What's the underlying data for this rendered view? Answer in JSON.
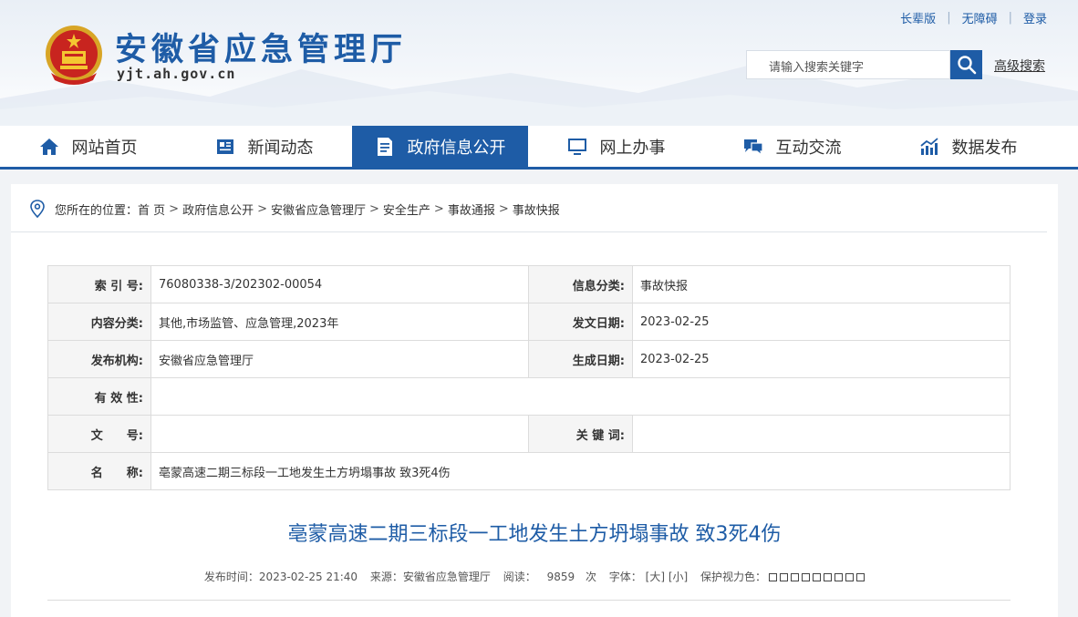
{
  "header": {
    "site_title": "安徽省应急管理厅",
    "site_domain": "yjt.ah.gov.cn",
    "top_links": [
      "长辈版",
      "无障碍",
      "登录"
    ],
    "search_placeholder": "请输入搜索关键字",
    "advanced_search": "高级搜索"
  },
  "nav": {
    "items": [
      {
        "label": "网站首页",
        "icon": "home-icon"
      },
      {
        "label": "新闻动态",
        "icon": "news-icon"
      },
      {
        "label": "政府信息公开",
        "icon": "document-icon",
        "active": true
      },
      {
        "label": "网上办事",
        "icon": "monitor-icon"
      },
      {
        "label": "互动交流",
        "icon": "chat-icon"
      },
      {
        "label": "数据发布",
        "icon": "chart-icon"
      }
    ]
  },
  "breadcrumb": {
    "prefix": "您所在的位置：",
    "items": [
      "首 页",
      "政府信息公开",
      "安徽省应急管理厅",
      "安全生产",
      "事故通报",
      "事故快报"
    ]
  },
  "meta": {
    "index_label": "索 引 号:",
    "index_value": "76080338-3/202302-00054",
    "category_label": "信息分类:",
    "category_value": "事故快报",
    "content_label": "内容分类:",
    "content_value": "其他,市场监管、应急管理,2023年",
    "issue_date_label": "发文日期:",
    "issue_date_value": "2023-02-25",
    "org_label": "发布机构:",
    "org_value": "安徽省应急管理厅",
    "gen_date_label": "生成日期:",
    "gen_date_value": "2023-02-25",
    "validity_label": "有 效 性:",
    "validity_value": "",
    "doc_no_label": "文　　号:",
    "doc_no_value": "",
    "keywords_label": "关 键 词:",
    "keywords_value": "",
    "name_label": "名　　称:",
    "name_value": "亳蒙高速二期三标段一工地发生土方坍塌事故 致3死4伤"
  },
  "article": {
    "title": "亳蒙高速二期三标段一工地发生土方坍塌事故 致3死4伤",
    "publish_time": "发布时间：2023-02-25 21:40",
    "source": "来源：安徽省应急管理厅",
    "views_label": "阅读：",
    "views": "9859",
    "views_unit": "次",
    "font_label": "字体：",
    "font_large": "[大]",
    "font_small": "[小]",
    "eye_color_label": "保护视力色："
  },
  "colors": {
    "brand": "#1e5ca6"
  }
}
